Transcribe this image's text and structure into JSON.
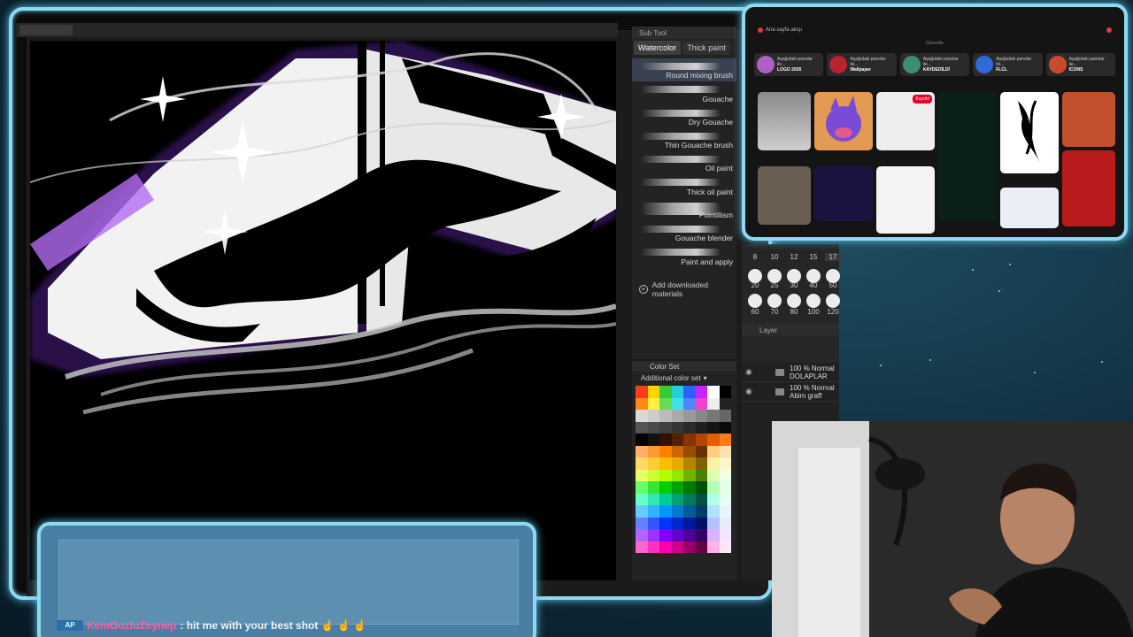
{
  "subtool": {
    "header": "Sub Tool",
    "tabs": [
      "Watercolor",
      "Thick paint"
    ],
    "brushes": [
      {
        "label": "Round mixing brush",
        "selected": true
      },
      {
        "label": "Gouache",
        "selected": false
      },
      {
        "label": "Dry Gouache",
        "selected": false
      },
      {
        "label": "Thin Gouache brush",
        "selected": false
      },
      {
        "label": "Oil paint",
        "selected": false
      },
      {
        "label": "Thick oil paint",
        "selected": false
      },
      {
        "label": "Pointillism",
        "selected": false
      },
      {
        "label": "Gouache blender",
        "selected": false
      },
      {
        "label": "Paint and apply",
        "selected": false
      }
    ],
    "add_materials": "Add downloaded materials"
  },
  "brush_sizes": {
    "row1": [
      "8",
      "10",
      "12",
      "15",
      "17"
    ],
    "row2": [
      "20",
      "25",
      "30",
      "40",
      "50"
    ],
    "row3": [
      "60",
      "70",
      "80",
      "100",
      "120"
    ],
    "selected": "17"
  },
  "layers": {
    "header": "Layer",
    "items": [
      {
        "blend": "100 % Normal",
        "name": "DOLAPLAR"
      },
      {
        "blend": "100 % Normal",
        "name": "Abim graff"
      }
    ]
  },
  "colorset": {
    "title": "Color Set",
    "selector": "Additional color set",
    "swatches": [
      "#ff3b1f",
      "#ffd400",
      "#33cc33",
      "#22cfe0",
      "#2a62ff",
      "#cc22ff",
      "#ffffff",
      "#000000",
      "#ff8a14",
      "#ffee44",
      "#66dd55",
      "#44e0e8",
      "#4f86ff",
      "#ee44cc",
      "#eeeeee",
      "#222222",
      "#d9d9d9",
      "#cccccc",
      "#bbbbbb",
      "#aaaaaa",
      "#999999",
      "#888888",
      "#777777",
      "#666666",
      "#555555",
      "#4a4a4a",
      "#404040",
      "#353535",
      "#2a2a2a",
      "#1f1f1f",
      "#151515",
      "#0a0a0a",
      "#000000",
      "#111111",
      "#331100",
      "#552200",
      "#883300",
      "#b34700",
      "#e65c00",
      "#ff7a1a",
      "#ffb266",
      "#ff9933",
      "#ff8000",
      "#cc6600",
      "#994d00",
      "#663300",
      "#ffcc80",
      "#ffe0b3",
      "#ffd966",
      "#ffcc33",
      "#ffbf00",
      "#e6ac00",
      "#b38600",
      "#806000",
      "#fff0a3",
      "#fff7cc",
      "#e6ff66",
      "#ccff33",
      "#b3ff00",
      "#99e600",
      "#73b300",
      "#4d8000",
      "#d9ffb3",
      "#f2ffe6",
      "#66ff66",
      "#33e633",
      "#00cc00",
      "#00a300",
      "#007a00",
      "#005200",
      "#b3ffb3",
      "#e6ffe6",
      "#66ffcc",
      "#33e6b3",
      "#00cc99",
      "#00a37a",
      "#007a5c",
      "#00523d",
      "#b3ffe6",
      "#e6fff7",
      "#66ccff",
      "#33b3ff",
      "#0099ff",
      "#007acc",
      "#005c99",
      "#003d66",
      "#b3e0ff",
      "#e6f5ff",
      "#6680ff",
      "#3355ff",
      "#0033ff",
      "#0026cc",
      "#001a99",
      "#001066",
      "#b3c2ff",
      "#e6ebff",
      "#b366ff",
      "#9933ff",
      "#8000ff",
      "#6600cc",
      "#4d0099",
      "#330066",
      "#d9b3ff",
      "#f2e6ff",
      "#ff66cc",
      "#ff33bb",
      "#ff00aa",
      "#cc0088",
      "#990066",
      "#660044",
      "#ffb3e6",
      "#ffe6f7"
    ]
  },
  "browser": {
    "brand": "Ana sayfa akışı",
    "subtitle": "Güncelle",
    "boards": [
      {
        "desc": "Aşağıdaki panolar ile...",
        "name": "LOGO 2026",
        "color": "#b05fc2"
      },
      {
        "desc": "Aşağıdaki panolar ile...",
        "name": "Wallpaper",
        "color": "#b8232f"
      },
      {
        "desc": "Aşağıdaki panolar ile...",
        "name": "KAYDEDİLDİ",
        "color": "#3c8f6a"
      },
      {
        "desc": "Aşağıdaki panolar ile...",
        "name": "FLCL",
        "color": "#2f6ad8"
      },
      {
        "desc": "Aşağıdaki panolar ile...",
        "name": "ICONS",
        "color": "#c94a2a"
      }
    ],
    "save_label": "Kaydet"
  },
  "chat": {
    "badge": "AP",
    "username": "KemGozluZeynep",
    "message": ": hit me with your best shot ☝ ☝ ☝"
  }
}
